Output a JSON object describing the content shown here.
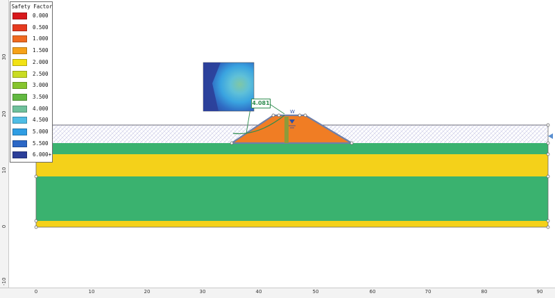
{
  "legend": {
    "title": "Safety Factor",
    "entries": [
      {
        "label": "0.000",
        "color": "#d7181c"
      },
      {
        "label": "0.500",
        "color": "#e63a1f"
      },
      {
        "label": "1.000",
        "color": "#f06a20"
      },
      {
        "label": "1.500",
        "color": "#f6a219"
      },
      {
        "label": "2.000",
        "color": "#f2e214"
      },
      {
        "label": "2.500",
        "color": "#c9dc22"
      },
      {
        "label": "3.000",
        "color": "#86c52e"
      },
      {
        "label": "3.500",
        "color": "#62b941"
      },
      {
        "label": "4.000",
        "color": "#6fc19c"
      },
      {
        "label": "4.500",
        "color": "#4fbde5"
      },
      {
        "label": "5.000",
        "color": "#2f9de3"
      },
      {
        "label": "5.500",
        "color": "#2b67c6"
      },
      {
        "label": "6.000+",
        "color": "#2c3f99"
      }
    ]
  },
  "axes": {
    "x_ticks": [
      "0",
      "10",
      "20",
      "30",
      "40",
      "50",
      "60",
      "70",
      "80",
      "90"
    ],
    "y_ticks": [
      "30",
      "20",
      "10",
      "0",
      "-10"
    ]
  },
  "slip_surface": {
    "factor_label": "4.081"
  },
  "water_marker": {
    "symbol": "W"
  },
  "colors": {
    "layer_green": "#3ab26f",
    "layer_yellow": "#f4d11a",
    "embankment": "#f07d24",
    "embankment_outline": "#6f7fa8",
    "boundary": "#7d7dc0",
    "accent_green": "#2d8c4e"
  }
}
